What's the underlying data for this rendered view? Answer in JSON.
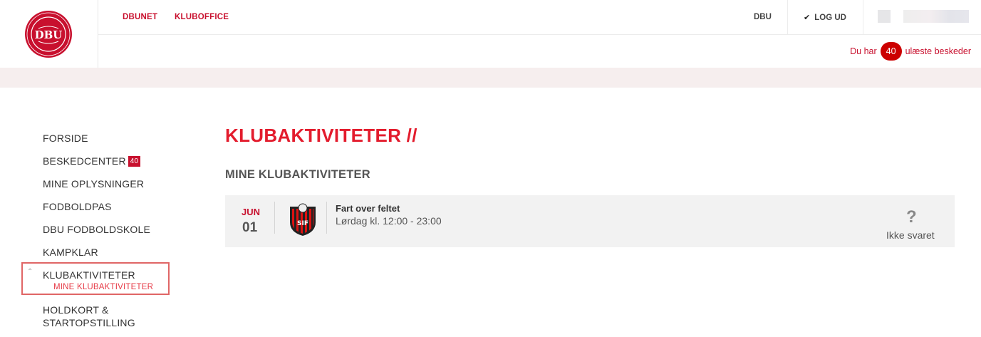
{
  "header": {
    "nav": [
      {
        "label": "DBUNET"
      },
      {
        "label": "KLUBOFFICE"
      }
    ],
    "dbu_label": "DBU",
    "logout_label": "LOG UD",
    "messages": {
      "prefix": "Du har",
      "count": "40",
      "suffix": "ulæste beskeder"
    },
    "logo_text": "DANSK BOLDSPIL-UNION 1889 DBU"
  },
  "sidebar": {
    "items": [
      {
        "label": "FORSIDE"
      },
      {
        "label": "BESKEDCENTER",
        "badge": "40"
      },
      {
        "label": "MINE OPLYSNINGER"
      },
      {
        "label": "FODBOLDPAS"
      },
      {
        "label": "DBU FODBOLDSKOLE"
      },
      {
        "label": "KAMPKLAR"
      },
      {
        "label": "KLUBAKTIVITETER"
      }
    ],
    "sub_active": "MINE KLUBAKTIVITETER",
    "multiline_item": "HOLDKORT & STARTOPSTILLING"
  },
  "main": {
    "title": "KLUBAKTIVITETER //",
    "section": "MINE KLUBAKTIVITETER",
    "activities": [
      {
        "month": "JUN",
        "day": "01",
        "title": "Fart over feltet",
        "time": "Lørdag kl. 12:00 - 23:00",
        "status_icon": "?",
        "status": "Ikke svaret"
      }
    ]
  },
  "colors": {
    "brand_red": "#c8102e",
    "title_red": "#e31c2d",
    "band": "#f6eeee",
    "card": "#f2f2f2"
  }
}
